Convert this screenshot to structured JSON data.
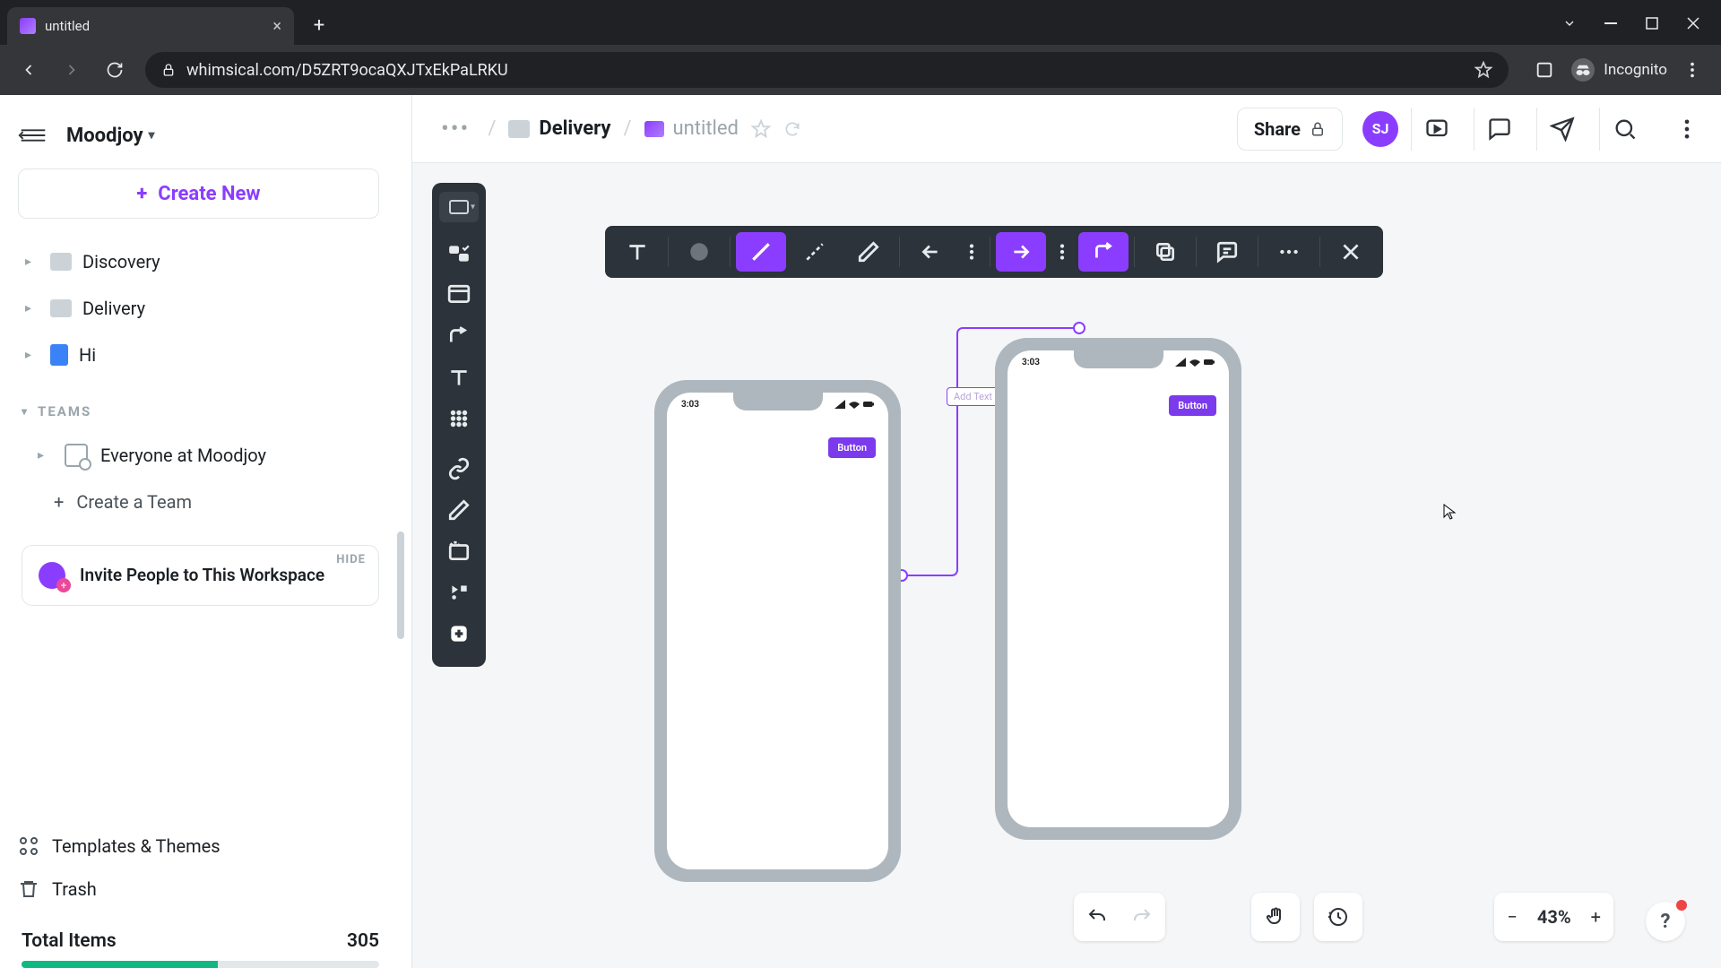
{
  "browser": {
    "tab_title": "untitled",
    "url": "whimsical.com/D5ZRT9ocaQXJTxEkPaLRKU",
    "incognito_label": "Incognito"
  },
  "workspace": {
    "name": "Moodjoy",
    "create_label": "Create New",
    "teams_label": "TEAMS",
    "team_name": "Everyone at Moodjoy",
    "create_team_label": "Create a Team",
    "invite_label": "Invite People to This Workspace",
    "invite_hide": "HIDE",
    "templates_label": "Templates & Themes",
    "trash_label": "Trash",
    "total_label": "Total Items",
    "total_value": "305",
    "progress_pct": 55
  },
  "tree": [
    {
      "type": "folder",
      "label": "Discovery"
    },
    {
      "type": "folder",
      "label": "Delivery"
    },
    {
      "type": "doc",
      "label": "Hi"
    }
  ],
  "header": {
    "parent": "Delivery",
    "current": "untitled",
    "share_label": "Share",
    "avatar_initials": "SJ"
  },
  "canvas": {
    "time": "3:03",
    "button_label": "Button",
    "flow_label_placeholder": "Add Text",
    "zoom": "43%"
  }
}
